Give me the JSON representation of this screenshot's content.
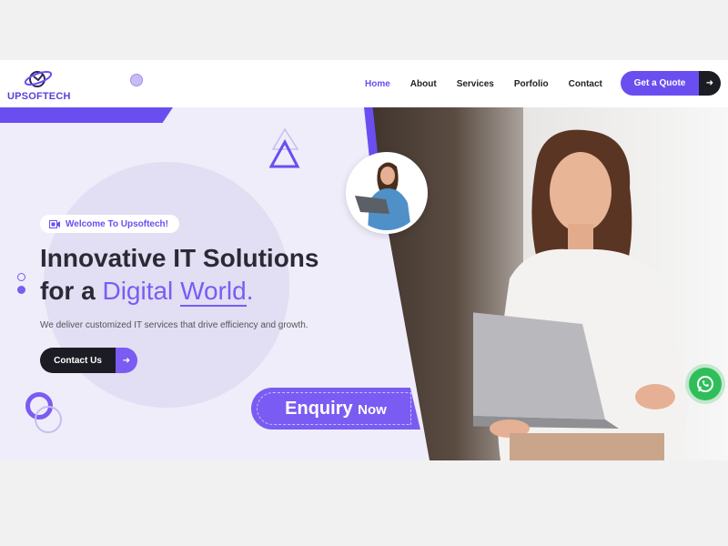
{
  "brand": {
    "logo_text": "UPSOFTECH"
  },
  "nav": {
    "items": [
      {
        "label": "Home",
        "active": true
      },
      {
        "label": "About",
        "active": false
      },
      {
        "label": "Services",
        "active": false
      },
      {
        "label": "Porfolio",
        "active": false
      },
      {
        "label": "Contact",
        "active": false
      }
    ],
    "cta_label": "Get a Quote",
    "cta_icon": "arrow-right-icon"
  },
  "hero": {
    "badge_text": "Welcome To Upsoftech!",
    "title_line1": "Innovative IT Solutions",
    "title_line2_prefix": "for a",
    "title_line2_highlight_a": "Digital",
    "title_line2_highlight_b": "World",
    "title_line2_suffix": ".",
    "subtitle": "We deliver customized IT services that drive efficiency and growth.",
    "contact_label": "Contact Us",
    "contact_icon": "arrow-right-icon"
  },
  "enquiry": {
    "main": "Enquiry",
    "small": "Now"
  },
  "colors": {
    "accent": "#6b4ef0",
    "dark": "#1c1c24",
    "whatsapp": "#2fbe5a"
  }
}
